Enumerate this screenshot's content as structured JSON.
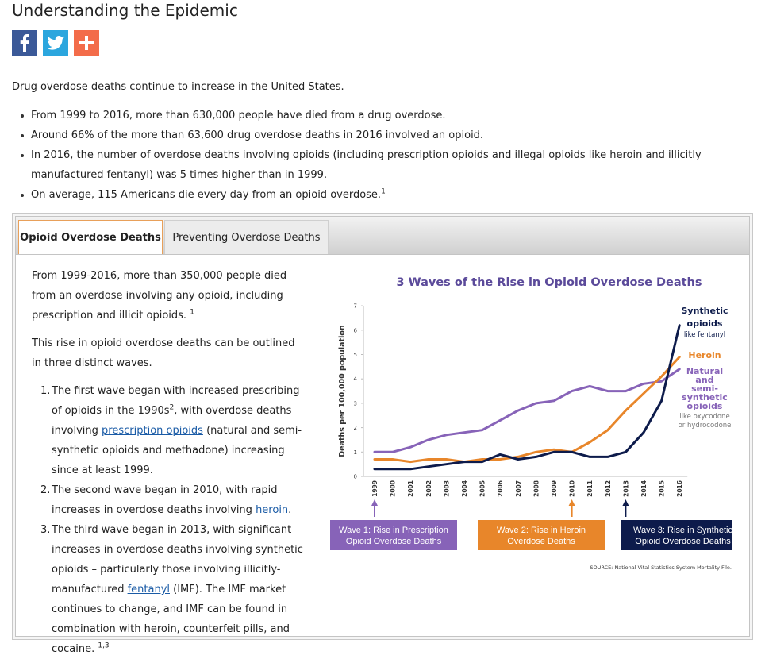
{
  "page": {
    "title": "Understanding the Epidemic",
    "intro": "Drug overdose deaths continue to increase in the United States."
  },
  "social": {
    "facebook_icon": "facebook-icon",
    "twitter_icon": "twitter-icon",
    "share_icon": "plus-share-icon",
    "colors": {
      "facebook": "#3b5998",
      "twitter": "#2ba6de",
      "share": "#f36c4a"
    }
  },
  "facts": [
    {
      "text": "From 1999 to 2016, more than 630,000 people have died from a drug overdose.",
      "sup": ""
    },
    {
      "text": "Around 66% of the more than 63,600 drug overdose deaths in 2016 involved an opioid.",
      "sup": ""
    },
    {
      "text": "In 2016, the number of overdose deaths involving opioids (including prescription opioids and illegal opioids like heroin and illicitly manufactured fentanyl) was 5 times higher than in 1999.",
      "sup": ""
    },
    {
      "text": "On average, 115 Americans die every day from an opioid overdose.",
      "sup": "1"
    }
  ],
  "tabs": [
    {
      "label": "Opioid Overdose Deaths",
      "active": true
    },
    {
      "label": "Preventing Overdose Deaths",
      "active": false
    }
  ],
  "panel": {
    "p1": "From 1999-2016, more than 350,000 people died from an overdose involving any opioid, including prescription and illicit opioids.",
    "p1_sup": "1",
    "p2": "This rise in opioid overdose deaths can be outlined in three distinct waves.",
    "waves": [
      {
        "num": "1.",
        "a": "The first wave began with increased prescribing of opioids in the 1990s",
        "sup1": "2",
        "b": ", with overdose deaths involving ",
        "link": "prescription opioids",
        "c": " (natural and semi-synthetic opioids and methadone) increasing since at least 1999."
      },
      {
        "num": "2.",
        "a": "The second wave began in 2010, with rapid increases in overdose deaths involving ",
        "link": "heroin",
        "b": "."
      },
      {
        "num": "3.",
        "a": "The third wave began in 2013, with significant increases in overdose deaths involving synthetic opioids – particularly those involving illicitly-manufactured ",
        "link": "fentanyl",
        "b": " (IMF). The IMF market continues to change, and IMF can be found in combination with heroin, counterfeit pills, and cocaine.",
        "sup": "1,3"
      }
    ]
  },
  "chart_data": {
    "type": "line",
    "title": "3 Waves of the Rise in Opioid Overdose Deaths",
    "ylabel": "Deaths per 100,000 population",
    "xlabel": "",
    "ylim": [
      0,
      7
    ],
    "yticks": [
      "0",
      "1",
      "2",
      "3",
      "4",
      "5",
      "6",
      "7"
    ],
    "categories": [
      "1999",
      "2000",
      "2001",
      "2002",
      "2003",
      "2004",
      "2005",
      "2006",
      "2007",
      "2008",
      "2009",
      "2010",
      "2011",
      "2012",
      "2013",
      "2014",
      "2015",
      "2016"
    ],
    "grid": false,
    "series": [
      {
        "name": "Synthetic opioids",
        "note": "like fentanyl",
        "color": "#0d1b4b",
        "values": [
          0.3,
          0.3,
          0.3,
          0.4,
          0.5,
          0.6,
          0.6,
          0.9,
          0.7,
          0.8,
          1.0,
          1.0,
          0.8,
          0.8,
          1.0,
          1.8,
          3.1,
          6.2
        ]
      },
      {
        "name": "Heroin",
        "note": "",
        "color": "#e8862a",
        "values": [
          0.7,
          0.7,
          0.6,
          0.7,
          0.7,
          0.6,
          0.7,
          0.7,
          0.8,
          1.0,
          1.1,
          1.0,
          1.4,
          1.9,
          2.7,
          3.4,
          4.1,
          4.9
        ]
      },
      {
        "name": "Natural and semi-synthetic opioids",
        "note": "like oxycodone or hydrocodone",
        "color": "#8763b8",
        "values": [
          1.0,
          1.0,
          1.2,
          1.5,
          1.7,
          1.8,
          1.9,
          2.3,
          2.7,
          3.0,
          3.1,
          3.5,
          3.7,
          3.5,
          3.5,
          3.8,
          3.9,
          4.4
        ]
      }
    ],
    "legend": {
      "synthetic_line1": "Synthetic",
      "synthetic_line2": "opioids",
      "synthetic_note": "like fentanyl",
      "heroin": "Heroin",
      "natural_line1": "Natural",
      "natural_line2": "and",
      "natural_line3": "semi-",
      "natural_line4": "synthetic",
      "natural_line5": "opioids",
      "natural_note1": "like oxycodone",
      "natural_note2": "or hydrocodone"
    },
    "waves": [
      {
        "line1": "Wave 1: Rise in Prescription",
        "line2": "Opioid Overdose Deaths",
        "year": "1999",
        "color": "#8763b8"
      },
      {
        "line1": "Wave 2: Rise in Heroin",
        "line2": "Overdose Deaths",
        "year": "2010",
        "color": "#e8862a"
      },
      {
        "line1": "Wave 3: Rise in Synthetic",
        "line2": "Opioid Overdose Deaths",
        "year": "2013",
        "color": "#0d1b4b"
      }
    ],
    "source": "SOURCE: National Vital Statistics System Mortality File."
  }
}
